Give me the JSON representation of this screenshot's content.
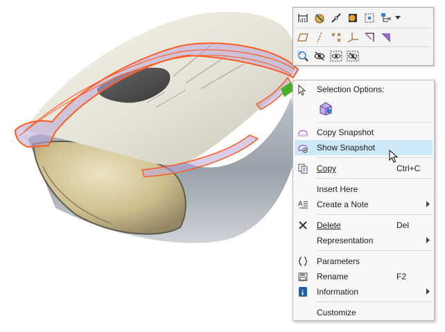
{
  "toolbar": {
    "row1": [
      "dimension-icon",
      "appearance-icon",
      "link-icon",
      "render-icon",
      "box-select-icon",
      "hierarchy-icon"
    ],
    "row2": [
      "plane-icon",
      "axis-icon",
      "points-icon",
      "csys-icon",
      "crop-icon",
      "shade-icon"
    ],
    "row3": [
      "zoom-to-selected-icon",
      "hide-icon",
      "show-icon",
      "hide-all-icon"
    ]
  },
  "menu": {
    "header": "Selection Options:",
    "items": {
      "copy_snapshot": {
        "label": "Copy Snapshot"
      },
      "show_snapshot": {
        "label": "Show Snapshot"
      },
      "copy": {
        "label": "Copy",
        "shortcut": "Ctrl+C"
      },
      "insert_here": {
        "label": "Insert Here"
      },
      "create_note": {
        "label": "Create a Note"
      },
      "delete": {
        "label": "Delete",
        "shortcut": "Del"
      },
      "representation": {
        "label": "Representation"
      },
      "parameters": {
        "label": "Parameters"
      },
      "rename": {
        "label": "Rename",
        "shortcut": "F2"
      },
      "information": {
        "label": "Information"
      },
      "customize": {
        "label": "Customize"
      }
    }
  },
  "colors": {
    "highlight": "#cde8f7",
    "selection_edge": "#ff5a1f",
    "selection_fill": "#b9a6d8"
  }
}
